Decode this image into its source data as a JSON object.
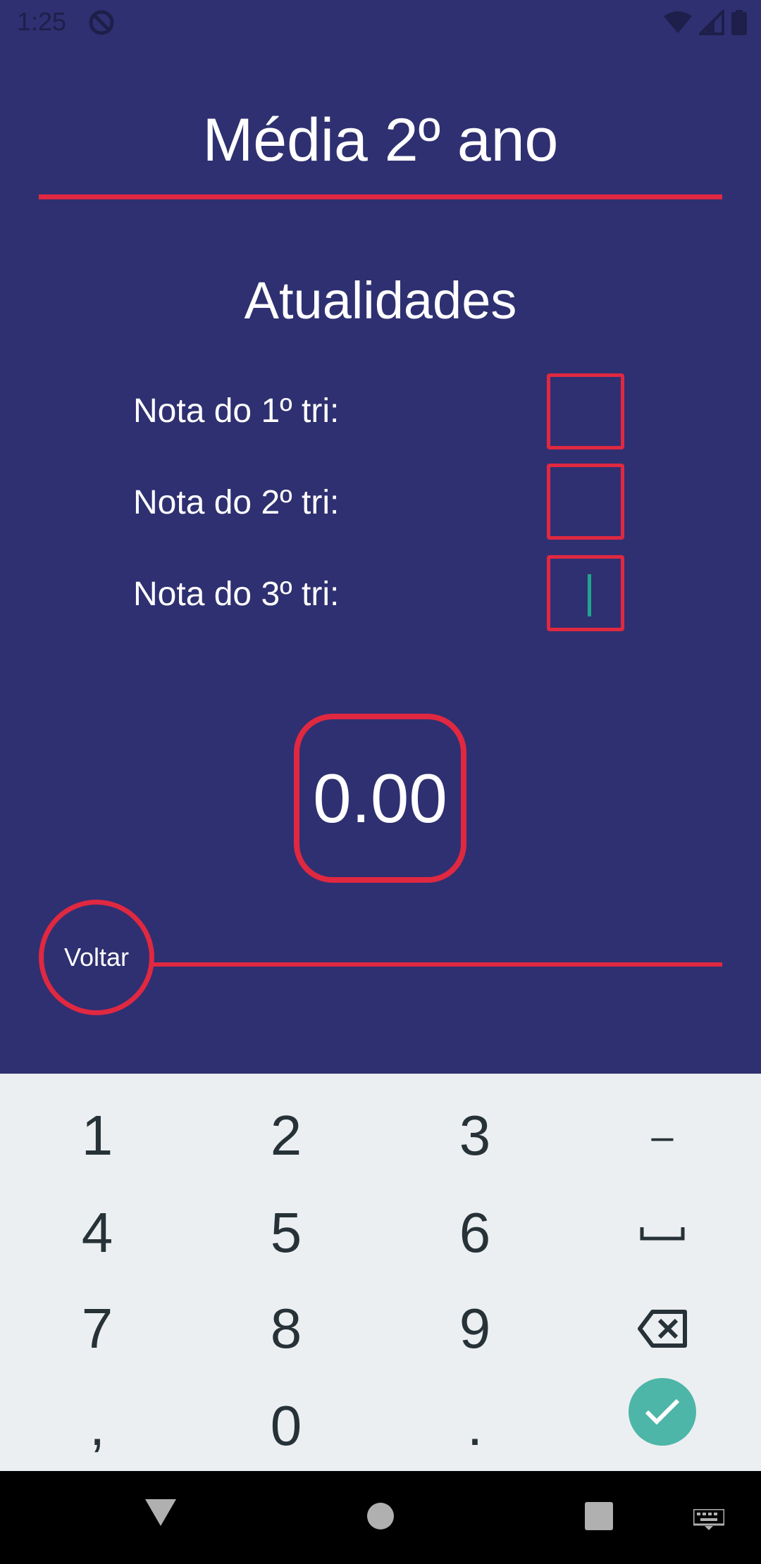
{
  "status_bar": {
    "time": "1:25",
    "icons": [
      "do-not-disturb-icon",
      "wifi-icon",
      "signal-icon",
      "battery-icon"
    ]
  },
  "header": {
    "title": "Média 2º ano"
  },
  "subject": {
    "name": "Atualidades"
  },
  "grades": [
    {
      "label": "Nota do 1º tri:",
      "value": ""
    },
    {
      "label": "Nota do 2º tri:",
      "value": ""
    },
    {
      "label": "Nota do 3º tri:",
      "value": ""
    }
  ],
  "result": {
    "average": "0.00"
  },
  "back_button": {
    "label": "Voltar"
  },
  "keyboard": {
    "rows": [
      [
        "1",
        "2",
        "3",
        "–"
      ],
      [
        "4",
        "5",
        "6",
        "␣"
      ],
      [
        "7",
        "8",
        "9",
        "⌫"
      ],
      [
        ",",
        "0",
        ".",
        "✓"
      ]
    ]
  },
  "colors": {
    "background": "#2f3071",
    "accent": "#e02841",
    "keyboard_bg": "#eceff1",
    "confirm": "#4db6a8"
  }
}
